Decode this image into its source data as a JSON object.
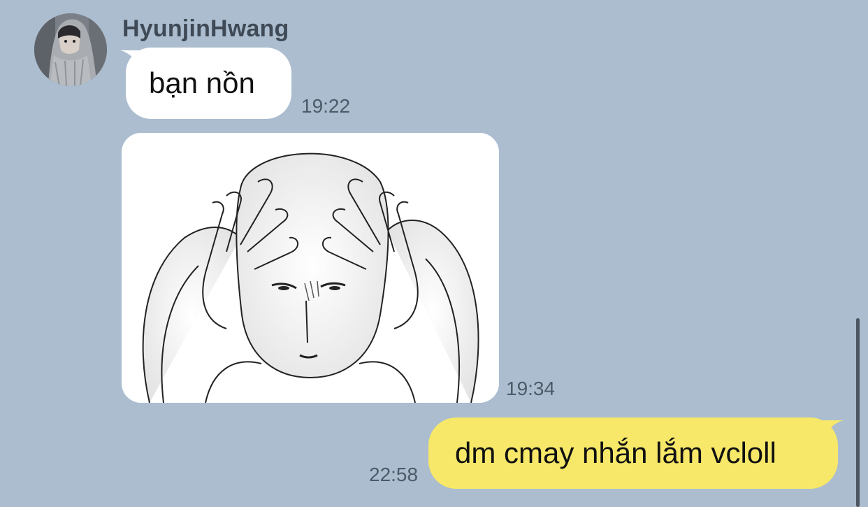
{
  "colors": {
    "background": "#abbdcf",
    "incoming_bubble": "#ffffff",
    "outgoing_bubble": "#f7e869",
    "sender_name": "#3f4a56",
    "timestamp": "#4d5a68"
  },
  "conversation": {
    "sender": {
      "name": "HyunjinHwang",
      "avatar_icon": "profile-photo"
    },
    "messages": [
      {
        "direction": "incoming",
        "type": "text",
        "text": "bạn nồn",
        "time": "19:22"
      },
      {
        "direction": "incoming",
        "type": "sticker",
        "sticker_icon": "stressed-man-holding-head-sticker",
        "time": "19:34"
      },
      {
        "direction": "outgoing",
        "type": "text",
        "text": "dm cmay nhắn lắm vcloll",
        "time": "22:58"
      }
    ]
  }
}
